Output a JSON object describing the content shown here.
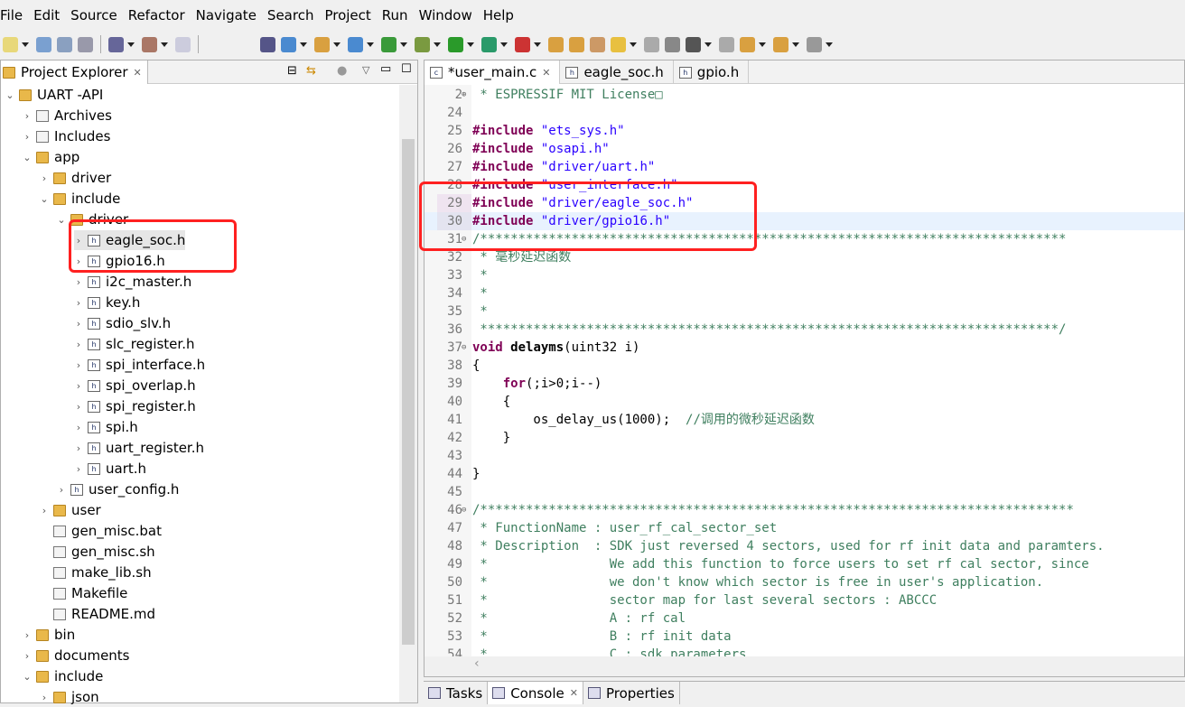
{
  "menu": [
    "File",
    "Edit",
    "Source",
    "Refactor",
    "Navigate",
    "Search",
    "Project",
    "Run",
    "Window",
    "Help"
  ],
  "explorer": {
    "title": "Project Explorer",
    "tree": [
      {
        "label": "UART -API",
        "level": 0,
        "type": "project",
        "state": "open"
      },
      {
        "label": "Archives",
        "level": 1,
        "type": "archives",
        "state": "closed"
      },
      {
        "label": "Includes",
        "level": 1,
        "type": "includes",
        "state": "closed"
      },
      {
        "label": "app",
        "level": 1,
        "type": "folder",
        "state": "open"
      },
      {
        "label": "driver",
        "level": 2,
        "type": "folder",
        "state": "closed"
      },
      {
        "label": "include",
        "level": 2,
        "type": "folder",
        "state": "open"
      },
      {
        "label": "driver",
        "level": 3,
        "type": "folder",
        "state": "open"
      },
      {
        "label": "eagle_soc.h",
        "level": 4,
        "type": "header",
        "state": "closed",
        "selected": true
      },
      {
        "label": "gpio16.h",
        "level": 4,
        "type": "header",
        "state": "closed"
      },
      {
        "label": "i2c_master.h",
        "level": 4,
        "type": "header",
        "state": "closed"
      },
      {
        "label": "key.h",
        "level": 4,
        "type": "header",
        "state": "closed"
      },
      {
        "label": "sdio_slv.h",
        "level": 4,
        "type": "header",
        "state": "closed"
      },
      {
        "label": "slc_register.h",
        "level": 4,
        "type": "header",
        "state": "closed"
      },
      {
        "label": "spi_interface.h",
        "level": 4,
        "type": "header",
        "state": "closed"
      },
      {
        "label": "spi_overlap.h",
        "level": 4,
        "type": "header",
        "state": "closed"
      },
      {
        "label": "spi_register.h",
        "level": 4,
        "type": "header",
        "state": "closed"
      },
      {
        "label": "spi.h",
        "level": 4,
        "type": "header",
        "state": "closed"
      },
      {
        "label": "uart_register.h",
        "level": 4,
        "type": "header",
        "state": "closed"
      },
      {
        "label": "uart.h",
        "level": 4,
        "type": "header",
        "state": "closed"
      },
      {
        "label": "user_config.h",
        "level": 3,
        "type": "header",
        "state": "closed"
      },
      {
        "label": "user",
        "level": 2,
        "type": "folder",
        "state": "closed"
      },
      {
        "label": "gen_misc.bat",
        "level": 2,
        "type": "file",
        "state": "none"
      },
      {
        "label": "gen_misc.sh",
        "level": 2,
        "type": "file",
        "state": "none"
      },
      {
        "label": "make_lib.sh",
        "level": 2,
        "type": "file",
        "state": "none"
      },
      {
        "label": "Makefile",
        "level": 2,
        "type": "makefile",
        "state": "none"
      },
      {
        "label": "README.md",
        "level": 2,
        "type": "file",
        "state": "none"
      },
      {
        "label": "bin",
        "level": 1,
        "type": "folder",
        "state": "closed"
      },
      {
        "label": "documents",
        "level": 1,
        "type": "folder",
        "state": "closed"
      },
      {
        "label": "include",
        "level": 1,
        "type": "folder",
        "state": "open"
      },
      {
        "label": "json",
        "level": 2,
        "type": "folder",
        "state": "closed"
      }
    ]
  },
  "editor": {
    "tabs": [
      {
        "label": "*user_main.c",
        "icon": "c-file-icon",
        "active": true
      },
      {
        "label": "eagle_soc.h",
        "icon": "h-file-icon"
      },
      {
        "label": "gpio.h",
        "icon": "h-file-icon"
      }
    ],
    "current_line": "30",
    "lines": [
      {
        "n": "2",
        "fold": "+",
        "seg": [
          [
            "cm",
            " * ESPRESSIF MIT License□"
          ]
        ]
      },
      {
        "n": "24",
        "seg": []
      },
      {
        "n": "25",
        "seg": [
          [
            "kw",
            "#include"
          ],
          [
            "",
            " "
          ],
          [
            "str",
            "\"ets_sys.h\""
          ]
        ]
      },
      {
        "n": "26",
        "seg": [
          [
            "kw",
            "#include"
          ],
          [
            "",
            " "
          ],
          [
            "str",
            "\"osapi.h\""
          ]
        ]
      },
      {
        "n": "27",
        "seg": [
          [
            "kw",
            "#include"
          ],
          [
            "",
            " "
          ],
          [
            "str",
            "\"driver/uart.h\""
          ]
        ]
      },
      {
        "n": "28",
        "seg": [
          [
            "kw",
            "#include"
          ],
          [
            "",
            " "
          ],
          [
            "str",
            "\"user_interface.h\""
          ]
        ]
      },
      {
        "n": "29",
        "seg": [
          [
            "kw",
            "#include"
          ],
          [
            "",
            " "
          ],
          [
            "str",
            "\"driver/eagle_soc.h\""
          ]
        ]
      },
      {
        "n": "30",
        "seg": [
          [
            "kw",
            "#include"
          ],
          [
            "",
            " "
          ],
          [
            "str",
            "\"driver/gpio16.h\""
          ]
        ]
      },
      {
        "n": "31",
        "fold": "-",
        "seg": [
          [
            "cm",
            "/*****************************************************************************"
          ]
        ]
      },
      {
        "n": "32",
        "seg": [
          [
            "cm",
            " * 毫秒延迟函数"
          ]
        ]
      },
      {
        "n": "33",
        "seg": [
          [
            "cm",
            " *"
          ]
        ]
      },
      {
        "n": "34",
        "seg": [
          [
            "cm",
            " *"
          ]
        ]
      },
      {
        "n": "35",
        "seg": [
          [
            "cm",
            " *"
          ]
        ]
      },
      {
        "n": "36",
        "seg": [
          [
            "cm",
            " ****************************************************************************/"
          ]
        ]
      },
      {
        "n": "37",
        "fold": "-",
        "seg": [
          [
            "kw",
            "void"
          ],
          [
            "",
            " "
          ],
          [
            "fn",
            "delayms"
          ],
          [
            "",
            "(uint32 i)"
          ]
        ]
      },
      {
        "n": "38",
        "seg": [
          [
            "",
            "{"
          ]
        ]
      },
      {
        "n": "39",
        "seg": [
          [
            "",
            "    "
          ],
          [
            "kw",
            "for"
          ],
          [
            "",
            "(;i>0;i--)"
          ]
        ]
      },
      {
        "n": "40",
        "seg": [
          [
            "",
            "    {"
          ]
        ]
      },
      {
        "n": "41",
        "seg": [
          [
            "",
            "        os_delay_us(1000);  "
          ],
          [
            "cm",
            "//调用的微秒延迟函数"
          ]
        ]
      },
      {
        "n": "42",
        "seg": [
          [
            "",
            "    }"
          ]
        ]
      },
      {
        "n": "43",
        "seg": []
      },
      {
        "n": "44",
        "seg": [
          [
            "",
            "}"
          ]
        ]
      },
      {
        "n": "45",
        "seg": []
      },
      {
        "n": "46",
        "fold": "-",
        "seg": [
          [
            "cm",
            "/******************************************************************************"
          ]
        ]
      },
      {
        "n": "47",
        "seg": [
          [
            "cm",
            " * FunctionName : user_rf_cal_sector_set"
          ]
        ]
      },
      {
        "n": "48",
        "seg": [
          [
            "cm",
            " * Description  : SDK just reversed 4 sectors, used for rf init data and paramters."
          ]
        ]
      },
      {
        "n": "49",
        "seg": [
          [
            "cm",
            " *                We add this function to force users to set rf cal sector, since"
          ]
        ]
      },
      {
        "n": "50",
        "seg": [
          [
            "cm",
            " *                we don't know which sector is free in user's application."
          ]
        ]
      },
      {
        "n": "51",
        "seg": [
          [
            "cm",
            " *                sector map for last several sectors : ABCCC"
          ]
        ]
      },
      {
        "n": "52",
        "seg": [
          [
            "cm",
            " *                A : rf cal"
          ]
        ]
      },
      {
        "n": "53",
        "seg": [
          [
            "cm",
            " *                B : rf init data"
          ]
        ]
      },
      {
        "n": "54",
        "seg": [
          [
            "cm",
            " *                C : sdk parameters"
          ]
        ]
      }
    ]
  },
  "bottom_tabs": [
    {
      "label": "Tasks",
      "icon": "tasks-icon"
    },
    {
      "label": "Console",
      "icon": "console-icon",
      "active": true
    },
    {
      "label": "Properties",
      "icon": "properties-icon"
    }
  ],
  "colors": {
    "keyword": "#7f0055",
    "string": "#2a00ff",
    "comment": "#3f7f5f",
    "highlight_box": "#ff2020"
  }
}
